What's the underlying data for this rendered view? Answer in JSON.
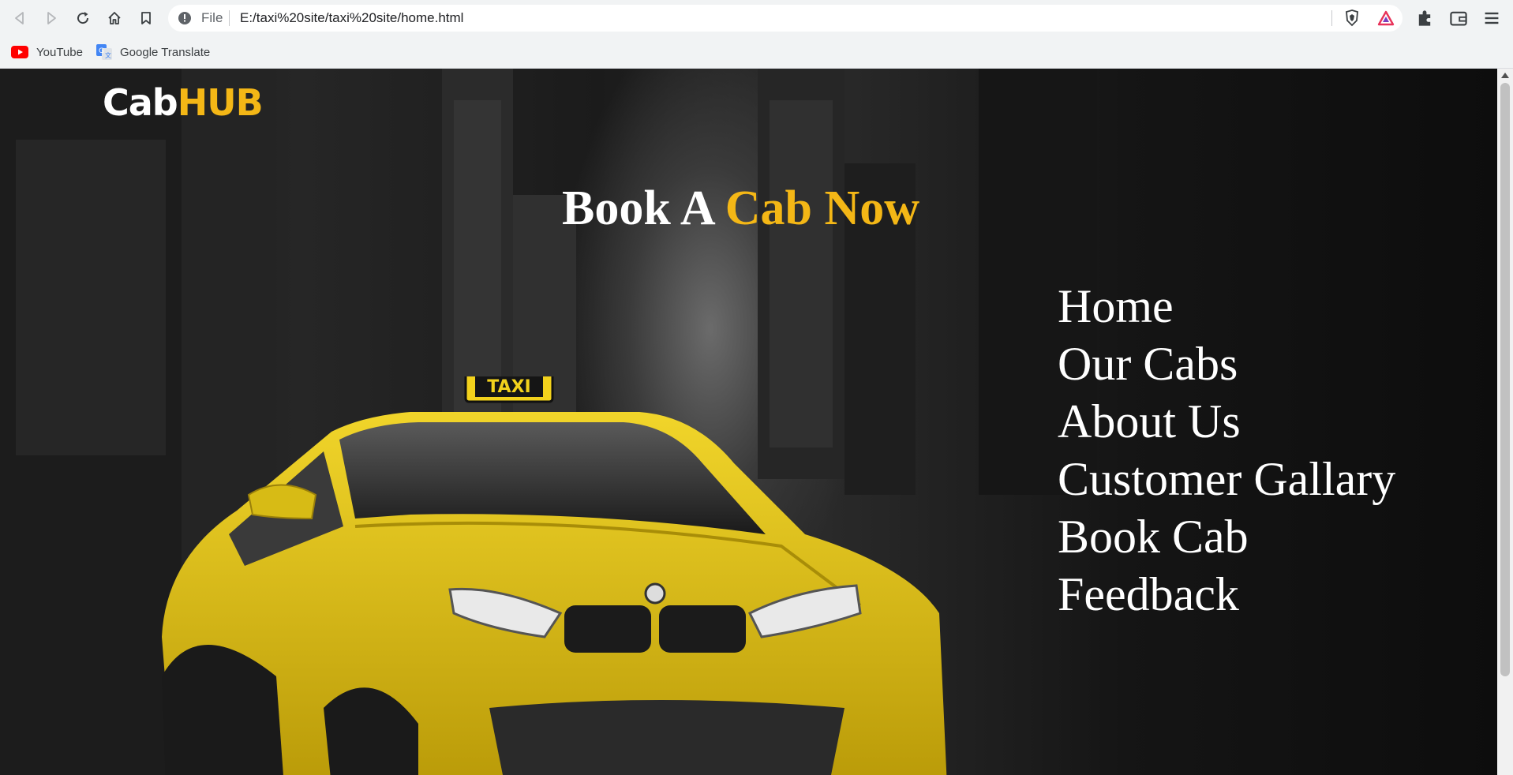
{
  "browser": {
    "scheme_label": "File",
    "url": "E:/taxi%20site/taxi%20site/home.html",
    "bookmarks": [
      {
        "label": "YouTube",
        "icon": "youtube-icon"
      },
      {
        "label": "Google Translate",
        "icon": "google-translate-icon"
      }
    ]
  },
  "site": {
    "logo_part1": "Cab",
    "logo_part2": "HUB",
    "headline_part1": "Book A ",
    "headline_part2": "Cab Now",
    "menu": [
      "Home",
      "Our Cabs",
      "About Us",
      "Customer Gallary",
      "Book Cab",
      "Feedback"
    ],
    "taxi_sign": "TAXI",
    "colors": {
      "accent": "#f4b716",
      "text": "#ffffff",
      "car": "#e3c417"
    }
  }
}
